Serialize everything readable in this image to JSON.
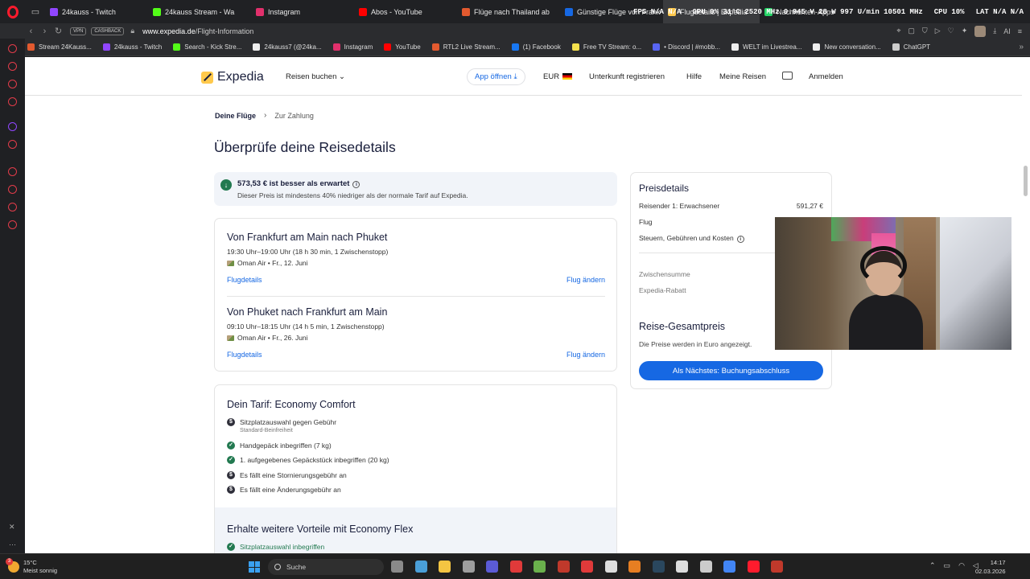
{
  "browser": {
    "tabs": [
      {
        "label": "24kauss - Twitch",
        "color": "#9146ff"
      },
      {
        "label": "24kauss Stream - Wa",
        "color": "#53fc18"
      },
      {
        "label": "Instagram",
        "color": "#e1306c"
      },
      {
        "label": "Abos - YouTube",
        "color": "#ff0000"
      },
      {
        "label": "Flüge nach Thailand ab",
        "color": "#e35a2f"
      },
      {
        "label": "Günstige Flüge von Frank",
        "color": "#1668e3"
      },
      {
        "label": "Flugdetails | Expedia",
        "color": "#ffc94c"
      },
      {
        "label": "Nachrichten-Apps",
        "color": "#25d366"
      }
    ],
    "stats": [
      "FPS N/A  N/A",
      "GPU 0%  31°C  2520 MHz  0.945 V  28 W  997 U/min  10501 MHz",
      "CPU 10%",
      "LAT N/A  N/A"
    ],
    "vpn_label": "VPN",
    "cashback_label": "CASHBACK",
    "url_domain": "www.expedia.de",
    "url_path": "/Flight-Information",
    "bookmarks": [
      {
        "label": "Stream 24Kauss...",
        "color": "#e35a2f"
      },
      {
        "label": "24kauss - Twitch",
        "color": "#9146ff"
      },
      {
        "label": "Search - Kick Stre...",
        "color": "#53fc18"
      },
      {
        "label": "24kauss7 (@24ka...",
        "color": "#eeeeee"
      },
      {
        "label": "Instagram",
        "color": "#e1306c"
      },
      {
        "label": "YouTube",
        "color": "#ff0000"
      },
      {
        "label": "RTL2 Live Stream...",
        "color": "#e35a2f"
      },
      {
        "label": "(1) Facebook",
        "color": "#1877f2"
      },
      {
        "label": "Free TV Stream: o...",
        "color": "#f4e04d"
      },
      {
        "label": "• Discord | #mobb...",
        "color": "#5865f2"
      },
      {
        "label": "WELT im Livestrea...",
        "color": "#eeeeee"
      },
      {
        "label": "New conversation...",
        "color": "#eeeeee"
      },
      {
        "label": "ChatGPT",
        "color": "#cccccc"
      }
    ]
  },
  "header": {
    "logo_text": "Expedia",
    "reisen_buchen": "Reisen buchen",
    "app_oeffnen": "App öffnen",
    "currency": "EUR",
    "unterkunft": "Unterkunft registrieren",
    "hilfe": "Hilfe",
    "meine_reisen": "Meine Reisen",
    "anmelden": "Anmelden"
  },
  "breadcrumb": {
    "current": "Deine Flüge",
    "next": "Zur Zahlung"
  },
  "page_title": "Überprüfe deine Reisedetails",
  "promo": {
    "title": "573,53 € ist besser als erwartet",
    "subtitle": "Dieser Preis ist mindestens 40% niedriger als der normale Tarif auf Expedia."
  },
  "flights": [
    {
      "title": "Von Frankfurt am Main nach Phuket",
      "time": "19:30 Uhr–19:00 Uhr (18 h 30 min, 1 Zwischenstopp)",
      "airline": "Oman Air • Fr., 12. Juni",
      "details_link": "Flugdetails",
      "change_link": "Flug ändern"
    },
    {
      "title": "Von Phuket nach Frankfurt am Main",
      "time": "09:10 Uhr–18:15 Uhr (14 h 5 min, 1 Zwischenstopp)",
      "airline": "Oman Air • Fr., 26. Juni",
      "details_link": "Flugdetails",
      "change_link": "Flug ändern"
    }
  ],
  "tarif": {
    "title": "Dein Tarif: Economy Comfort",
    "features": [
      {
        "icon": "fee",
        "text": "Sitzplatzauswahl gegen Gebühr",
        "sub": "Standard-Beinfreiheit"
      },
      {
        "icon": "check",
        "text": "Handgepäck inbegriffen (7 kg)"
      },
      {
        "icon": "check",
        "text": "1. aufgegebenes Gepäckstück inbegriffen (20 kg)"
      },
      {
        "icon": "fee",
        "text": "Es fällt eine Stornierungsgebühr an"
      },
      {
        "icon": "fee",
        "text": "Es fällt eine Änderungsgebühr an"
      }
    ],
    "upsell_title": "Erhalte weitere Vorteile mit Economy Flex",
    "upsell_feature": "Sitzplatzauswahl inbegriffen"
  },
  "price": {
    "title": "Preisdetails",
    "rows": [
      {
        "label": "Reisender 1: Erwachsener",
        "value": "591,27 €"
      },
      {
        "label": "Flug",
        "value": ""
      },
      {
        "label": "Steuern, Gebühren und Kosten",
        "value": ""
      }
    ],
    "subtotal_label": "Zwischensumme",
    "rabatt_label": "Expedia-Rabatt",
    "total_title": "Reise-Gesamtpreis",
    "total_sub": "Die Preise werden in Euro angezeigt.",
    "cta": "Als Nächstes: Buchungsabschluss"
  },
  "taskbar": {
    "weather_temp": "15°C",
    "weather_text": "Meist sonnig",
    "weather_badge": "3",
    "search_placeholder": "Suche",
    "apps": [
      "#8a8a8a",
      "#4a9fd8",
      "#f4c542",
      "#9e9e9e",
      "#5b5bd6",
      "#e03a3a",
      "#6ab04c",
      "#c0392b",
      "#e03a3a",
      "#dddddd",
      "#e67e22",
      "#2a475e",
      "#dddddd",
      "#cccccc",
      "#4285f4",
      "#ff1b2d",
      "#c0392b"
    ],
    "time": "14:17",
    "date": "02.03.2026"
  }
}
